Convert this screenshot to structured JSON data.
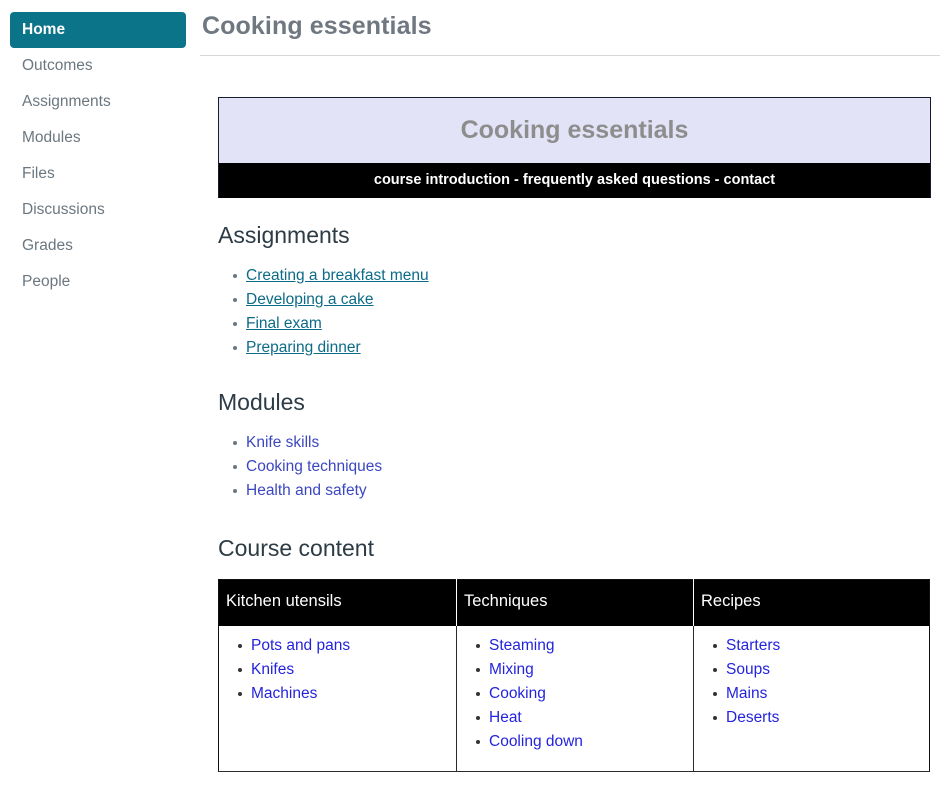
{
  "sidebar": {
    "items": [
      {
        "label": "Home",
        "active": true
      },
      {
        "label": "Outcomes",
        "active": false
      },
      {
        "label": "Assignments",
        "active": false
      },
      {
        "label": "Modules",
        "active": false
      },
      {
        "label": "Files",
        "active": false
      },
      {
        "label": "Discussions",
        "active": false
      },
      {
        "label": "Grades",
        "active": false
      },
      {
        "label": "People",
        "active": false
      }
    ],
    "active_color": "#0b7489",
    "text_color": "#6b7780"
  },
  "header": {
    "page_title": "Cooking essentials"
  },
  "banner": {
    "title": "Cooking essentials",
    "nav_text": "course introduction - frequently asked questions - contact",
    "title_bg": "#e2e3f7",
    "title_color": "#8d8d8d",
    "nav_bg": "#000000",
    "nav_color": "#ffffff"
  },
  "assignments": {
    "heading": "Assignments",
    "link_color": "#0d6b87",
    "items": [
      {
        "label": "Creating a breakfast menu"
      },
      {
        "label": "Developing a cake"
      },
      {
        "label": "Final exam"
      },
      {
        "label": "Preparing dinner"
      }
    ]
  },
  "modules": {
    "heading": "Modules",
    "link_color": "#3b47c0",
    "items": [
      {
        "label": "Knife skills"
      },
      {
        "label": "Cooking techniques"
      },
      {
        "label": "Health and safety"
      }
    ]
  },
  "course_content": {
    "heading": "Course content",
    "link_color": "#2323dd",
    "header_bg": "#000000",
    "columns": [
      {
        "header": "Kitchen utensils",
        "items": [
          {
            "label": "Pots and pans"
          },
          {
            "label": "Knifes"
          },
          {
            "label": "Machines"
          }
        ]
      },
      {
        "header": "Techniques",
        "items": [
          {
            "label": "Steaming"
          },
          {
            "label": "Mixing"
          },
          {
            "label": "Cooking"
          },
          {
            "label": "Heat"
          },
          {
            "label": "Cooling down"
          }
        ]
      },
      {
        "header": "Recipes",
        "items": [
          {
            "label": "Starters"
          },
          {
            "label": "Soups"
          },
          {
            "label": "Mains"
          },
          {
            "label": "Deserts"
          }
        ]
      }
    ]
  }
}
